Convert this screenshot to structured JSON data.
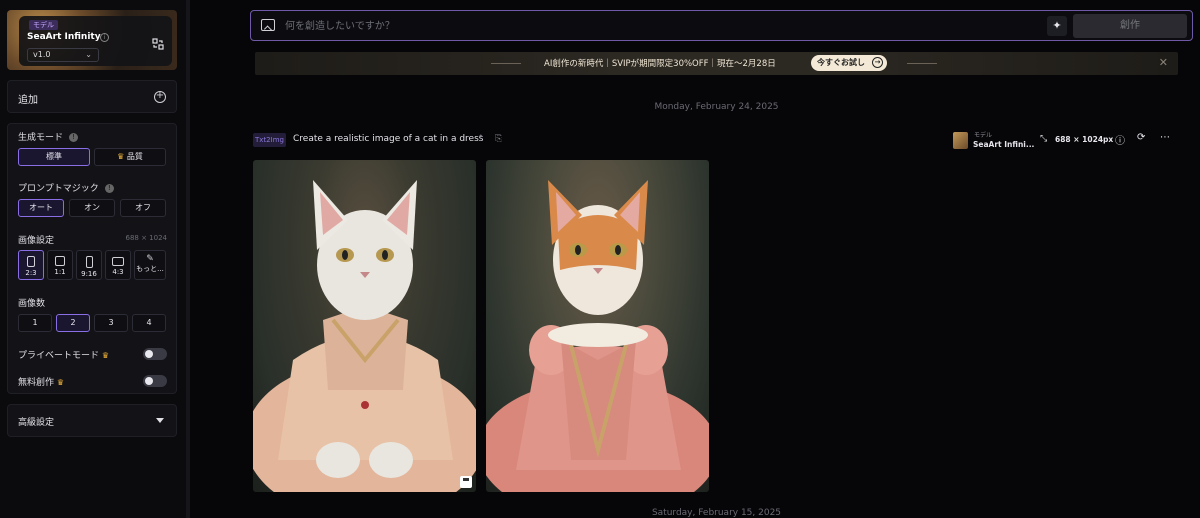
{
  "sidebar": {
    "model": {
      "tag": "モデル",
      "name": "SeaArt Infinity",
      "version": "v1.0"
    },
    "add": {
      "label": "追加"
    },
    "generation_mode": {
      "label": "生成モード",
      "options": [
        "標準",
        "品質"
      ],
      "selected": "標準"
    },
    "prompt_magic": {
      "label": "プロンプトマジック",
      "options": [
        "オート",
        "オン",
        "オフ"
      ],
      "selected": "オート"
    },
    "image_settings": {
      "label": "画像設定",
      "value": "688 × 1024",
      "ratios": [
        "2:3",
        "1:1",
        "9:16",
        "4:3",
        "もっと..."
      ],
      "selected": "2:3"
    },
    "image_count": {
      "label": "画像数",
      "options": [
        "1",
        "2",
        "3",
        "4"
      ],
      "selected": "2"
    },
    "private_mode": {
      "label": "プライベートモード",
      "enabled": false
    },
    "free_create": {
      "label": "無料創作",
      "enabled": false
    },
    "advanced": {
      "label": "高級設定"
    }
  },
  "prompt_bar": {
    "placeholder": "何を創造したいですか？",
    "create_label": "創作"
  },
  "promo": {
    "text": "AI創作の新時代｜SVIPが期間限定30%OFF｜現在～2月28日",
    "button": "今すぐお試し"
  },
  "feed": {
    "date_1": "Monday, February 24, 2025",
    "date_2": "Saturday, February 15, 2025",
    "task": {
      "type": "Txt2Img",
      "prompt": "Create a realistic image of a cat in a dress",
      "model_tag": "モデル",
      "model_name": "SeaArt Infini...",
      "size": "688 × 1024px"
    }
  },
  "colors": {
    "accent": "#8a6ee6",
    "background": "#060608",
    "panel": "#121217",
    "promo_button": "#f3e9d6"
  }
}
